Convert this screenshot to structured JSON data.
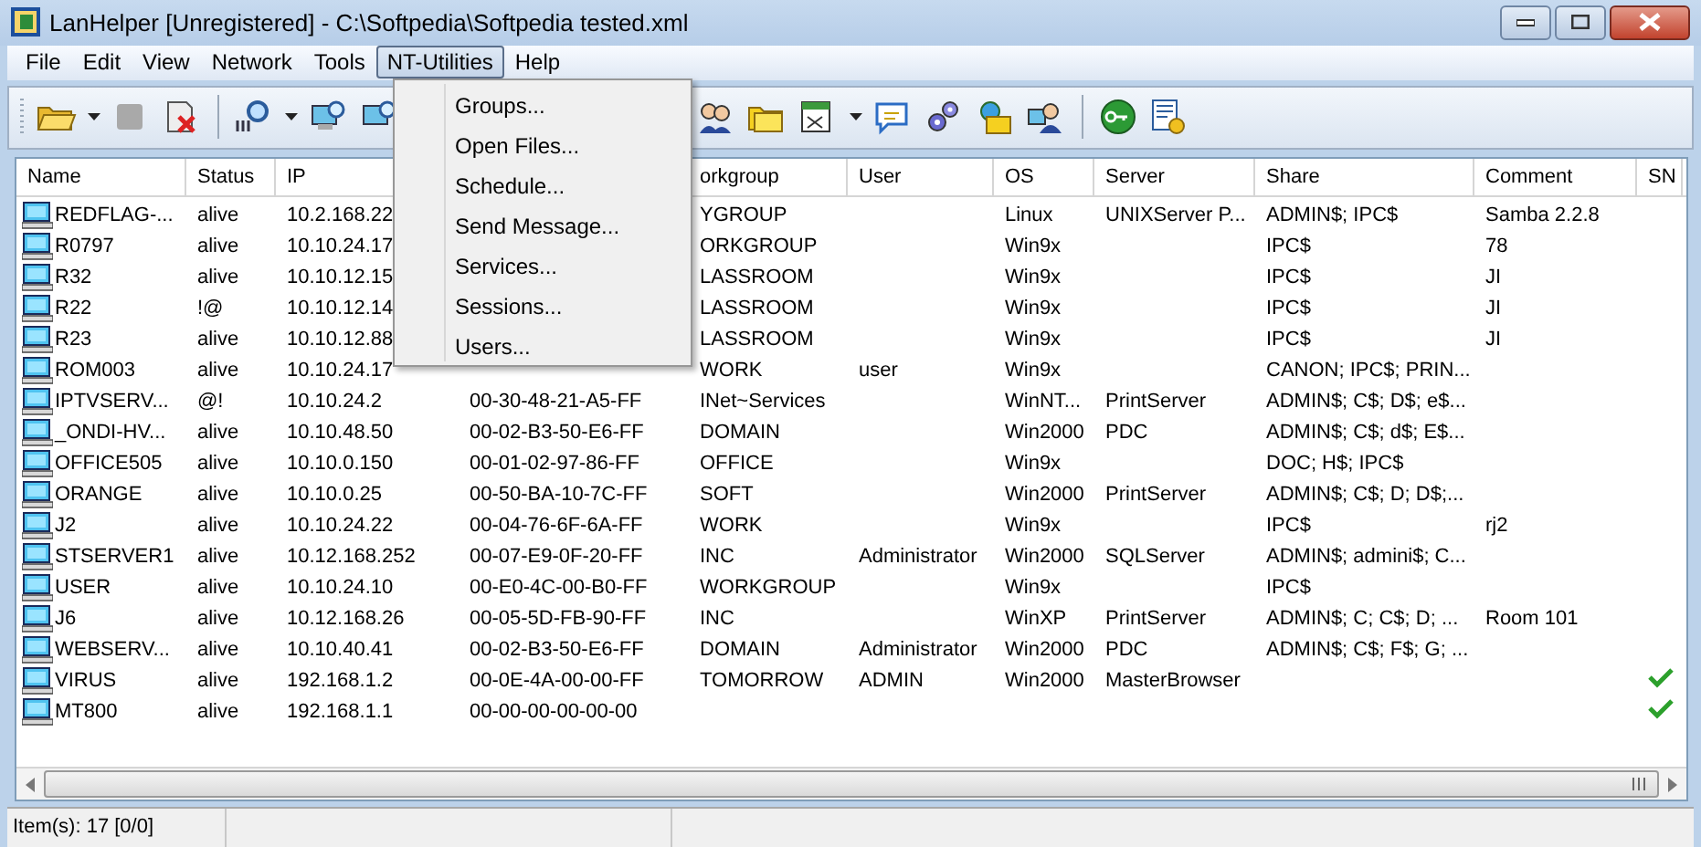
{
  "window": {
    "title": "LanHelper [Unregistered] - C:\\Softpedia\\Softpedia tested.xml"
  },
  "menu_bar": [
    {
      "label": "File",
      "selected": false
    },
    {
      "label": "Edit",
      "selected": false
    },
    {
      "label": "View",
      "selected": false
    },
    {
      "label": "Network",
      "selected": false
    },
    {
      "label": "Tools",
      "selected": false
    },
    {
      "label": "NT-Utilities",
      "selected": true
    },
    {
      "label": "Help",
      "selected": false
    }
  ],
  "dropdown_menu": {
    "items": [
      "Groups...",
      "Open Files...",
      "Schedule...",
      "Send Message...",
      "Services...",
      "Sessions...",
      "Users..."
    ]
  },
  "table": {
    "columns": {
      "name": "Name",
      "status": "Status",
      "ip": "IP",
      "workgroup": "orkgroup",
      "user": "User",
      "os": "OS",
      "server": "Server",
      "share": "Share",
      "comment": "Comment",
      "sn": "SN"
    },
    "rows": [
      {
        "name": "REDFLAG-...",
        "status": "alive",
        "ip": "10.2.168.22",
        "workgroup": "YGROUP",
        "os": "Linux",
        "server": "UNIXServer P...",
        "share": "ADMIN$; IPC$",
        "comment": "Samba 2.2.8",
        "sn": false
      },
      {
        "name": "R0797",
        "status": "alive",
        "ip": "10.10.24.17",
        "workgroup": "ORKGROUP",
        "os": "Win9x",
        "share": "IPC$",
        "comment": "78",
        "sn": false
      },
      {
        "name": "R32",
        "status": "alive",
        "ip": "10.10.12.15",
        "workgroup": "LASSROOM",
        "os": "Win9x",
        "share": "IPC$",
        "comment": "JI",
        "sn": false
      },
      {
        "name": "R22",
        "status": "!@",
        "ip": "10.10.12.14",
        "workgroup": "LASSROOM",
        "os": "Win9x",
        "share": "IPC$",
        "comment": "JI",
        "sn": false
      },
      {
        "name": "R23",
        "status": "alive",
        "ip": "10.10.12.88",
        "workgroup": "LASSROOM",
        "os": "Win9x",
        "share": "IPC$",
        "comment": "JI",
        "sn": false
      },
      {
        "name": "ROM003",
        "status": "alive",
        "ip": "10.10.24.17",
        "workgroup": "WORK",
        "user": "user",
        "os": "Win9x",
        "share": "CANON; IPC$; PRIN...",
        "sn": false
      },
      {
        "name": "IPTVSERV...",
        "status": "@!",
        "ip": "10.10.24.2",
        "column_4": "00-30-48-21-A5-FF",
        "workgroup": "INet~Services",
        "os": "WinNT...",
        "server": "PrintServer",
        "share": "ADMIN$; C$; D$; e$...",
        "sn": false
      },
      {
        "name": "_ONDI-HV...",
        "status": "alive",
        "ip": "10.10.48.50",
        "column_4": "00-02-B3-50-E6-FF",
        "workgroup": "DOMAIN",
        "os": "Win2000",
        "server": "PDC",
        "share": "ADMIN$; C$; d$; E$...",
        "sn": false
      },
      {
        "name": "OFFICE505",
        "status": "alive",
        "ip": "10.10.0.150",
        "column_4": "00-01-02-97-86-FF",
        "workgroup": "OFFICE",
        "os": "Win9x",
        "share": "DOC; H$; IPC$",
        "sn": false
      },
      {
        "name": "ORANGE",
        "status": "alive",
        "ip": "10.10.0.25",
        "column_4": "00-50-BA-10-7C-FF",
        "workgroup": "SOFT",
        "os": "Win2000",
        "server": "PrintServer",
        "share": "ADMIN$; C$; D; D$;...",
        "sn": false
      },
      {
        "name": "J2",
        "status": "alive",
        "ip": "10.10.24.22",
        "column_4": "00-04-76-6F-6A-FF",
        "workgroup": "WORK",
        "os": "Win9x",
        "share": "IPC$",
        "comment": "rj2",
        "sn": false
      },
      {
        "name": "STSERVER1",
        "status": "alive",
        "ip": "10.12.168.252",
        "column_4": "00-07-E9-0F-20-FF",
        "workgroup": "INC",
        "user": "Administrator",
        "os": "Win2000",
        "server": "SQLServer",
        "share": "ADMIN$; admini$; C...",
        "sn": false
      },
      {
        "name": "USER",
        "status": "alive",
        "ip": "10.10.24.10",
        "column_4": "00-E0-4C-00-B0-FF",
        "workgroup": "WORKGROUP",
        "os": "Win9x",
        "share": "IPC$",
        "sn": false
      },
      {
        "name": "J6",
        "status": "alive",
        "ip": "10.12.168.26",
        "column_4": "00-05-5D-FB-90-FF",
        "workgroup": "INC",
        "os": "WinXP",
        "server": "PrintServer",
        "share": "ADMIN$; C; C$; D; ...",
        "comment": "Room 101",
        "sn": false
      },
      {
        "name": "WEBSERV...",
        "status": "alive",
        "ip": "10.10.40.41",
        "column_4": "00-02-B3-50-E6-FF",
        "workgroup": "DOMAIN",
        "user": "Administrator",
        "os": "Win2000",
        "server": "PDC",
        "share": "ADMIN$; C$; F$; G; ...",
        "sn": false
      },
      {
        "name": "VIRUS",
        "status": "alive",
        "ip": "192.168.1.2",
        "column_4": "00-0E-4A-00-00-FF",
        "workgroup": "TOMORROW",
        "user": "ADMIN",
        "os": "Win2000",
        "server": "MasterBrowser",
        "sn": true
      },
      {
        "name": "MT800",
        "status": "alive",
        "ip": "192.168.1.1",
        "column_4": "00-00-00-00-00-00",
        "sn": true
      }
    ]
  },
  "status_bar": {
    "text": "Item(s): 17 [0/0]"
  }
}
